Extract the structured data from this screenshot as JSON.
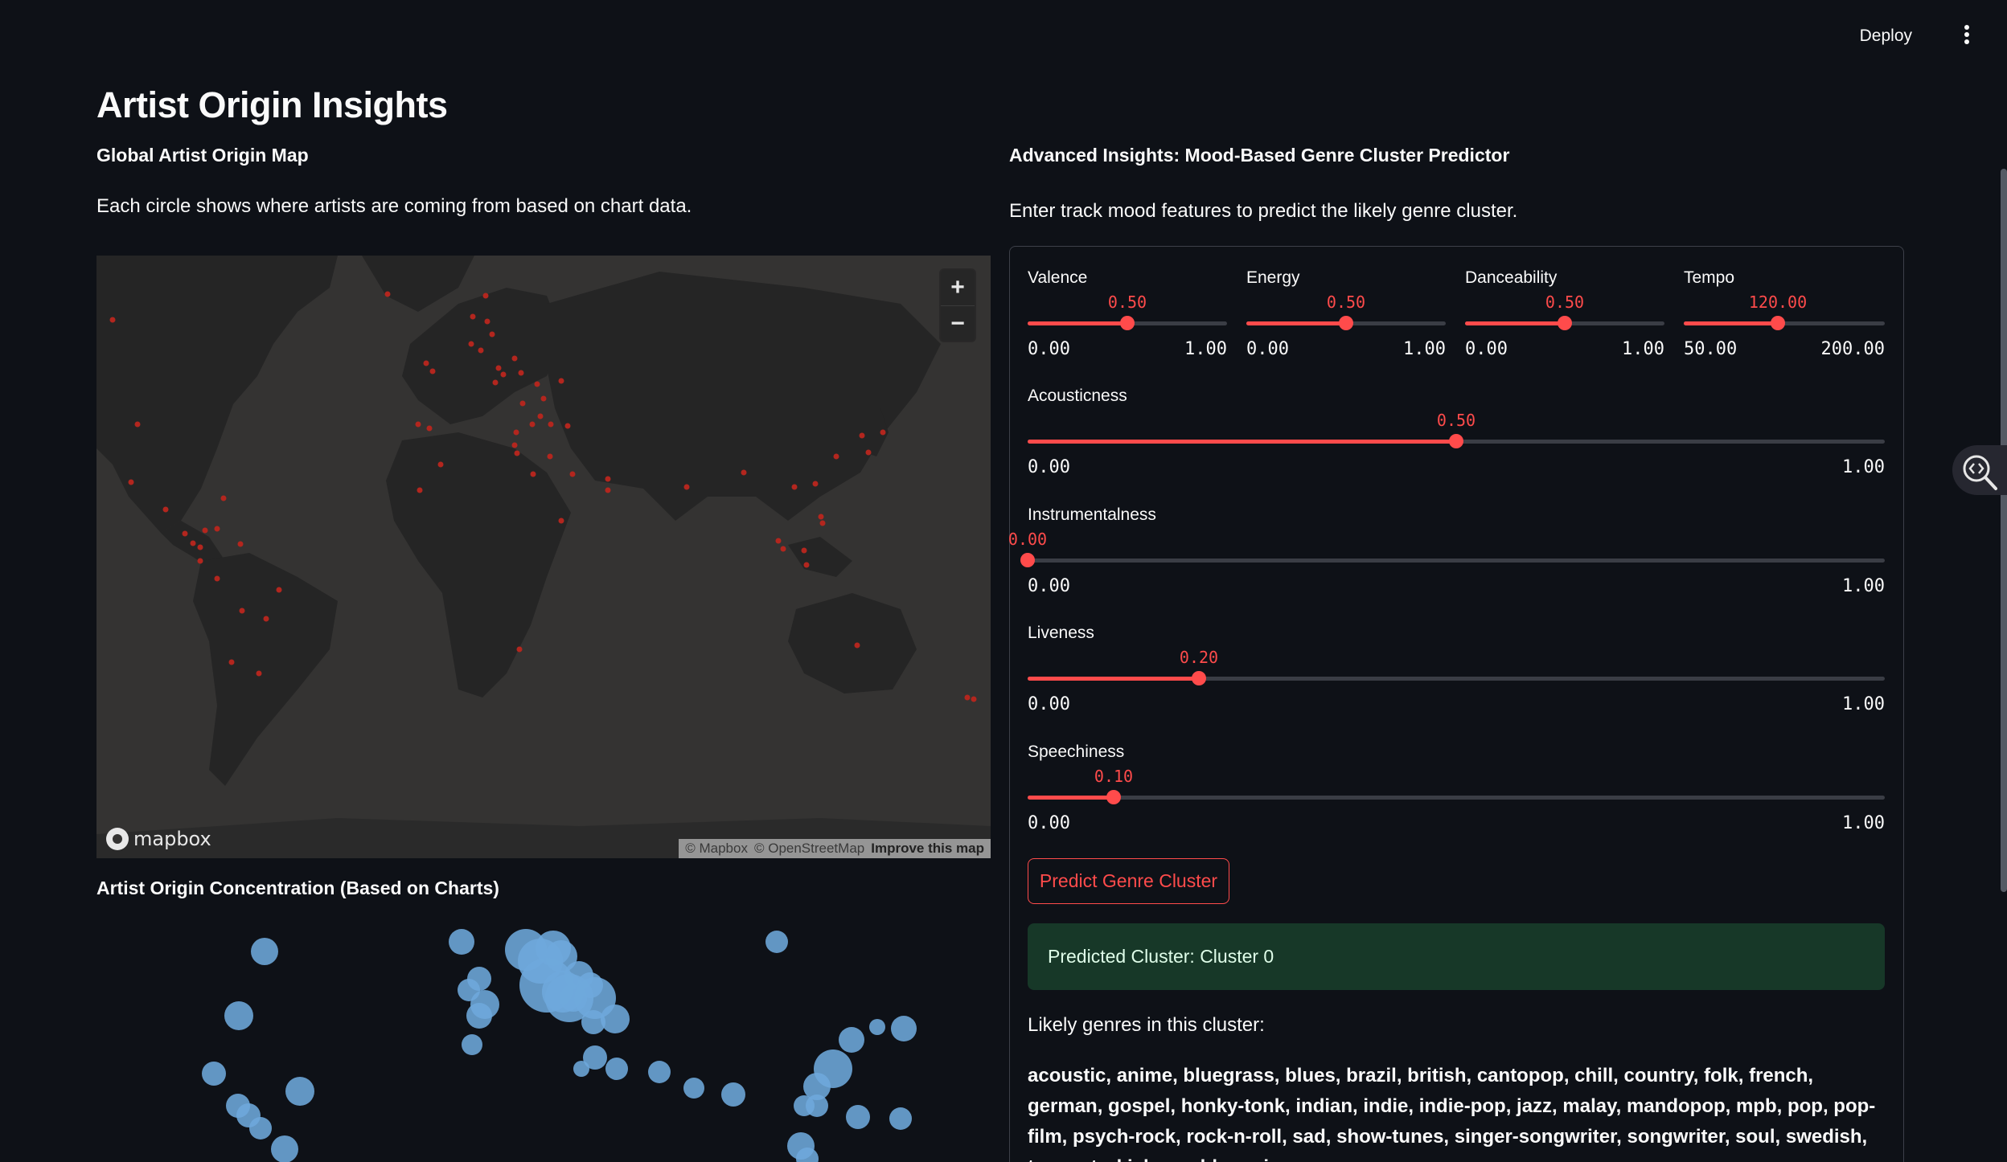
{
  "header": {
    "deploy_label": "Deploy"
  },
  "page": {
    "title": "Artist Origin Insights"
  },
  "left": {
    "map_heading": "Global Artist Origin Map",
    "map_description": "Each circle shows where artists are coming from based on chart data.",
    "map": {
      "zoom_in": "+",
      "zoom_out": "−",
      "logo": "mapbox",
      "attribution_mapbox": "© Mapbox",
      "attribution_osm": "© OpenStreetMap",
      "improve": "Improve this map"
    },
    "concentration_heading": "Artist Origin Concentration (Based on Charts)"
  },
  "right": {
    "heading": "Advanced Insights: Mood-Based Genre Cluster Predictor",
    "description": "Enter track mood features to predict the likely genre cluster.",
    "sliders": {
      "valence": {
        "label": "Valence",
        "value": "0.50",
        "min": "0.00",
        "max": "1.00",
        "fraction": 0.5
      },
      "energy": {
        "label": "Energy",
        "value": "0.50",
        "min": "0.00",
        "max": "1.00",
        "fraction": 0.5
      },
      "danceability": {
        "label": "Danceability",
        "value": "0.50",
        "min": "0.00",
        "max": "1.00",
        "fraction": 0.5
      },
      "tempo": {
        "label": "Tempo",
        "value": "120.00",
        "min": "50.00",
        "max": "200.00",
        "fraction": 0.4667
      },
      "acousticness": {
        "label": "Acousticness",
        "value": "0.50",
        "min": "0.00",
        "max": "1.00",
        "fraction": 0.5
      },
      "instrumentalness": {
        "label": "Instrumentalness",
        "value": "0.00",
        "min": "0.00",
        "max": "1.00",
        "fraction": 0.0
      },
      "liveness": {
        "label": "Liveness",
        "value": "0.20",
        "min": "0.00",
        "max": "1.00",
        "fraction": 0.2
      },
      "speechiness": {
        "label": "Speechiness",
        "value": "0.10",
        "min": "0.00",
        "max": "1.00",
        "fraction": 0.1
      }
    },
    "predict_button": "Predict Genre Cluster",
    "result": "Predicted Cluster: Cluster 0",
    "likely_label": "Likely genres in this cluster:",
    "genres": "acoustic, anime, bluegrass, blues, brazil, british, cantopop, chill, country, folk, french, german, gospel, honky-tonk, indian, indie, indie-pop, jazz, malay, mandopop, mpb, pop, pop-film, psych-rock, rock-n-roll, sad, show-tunes, singer-songwriter, songwriter, soul, swedish, tango, turkish, world-music"
  },
  "colors": {
    "accent": "#ff4b4b",
    "success_bg": "#173828",
    "map_land": "#252525",
    "map_water": "#343332",
    "map_point": "#b3261e",
    "bubble": "#6ea8dc"
  }
}
